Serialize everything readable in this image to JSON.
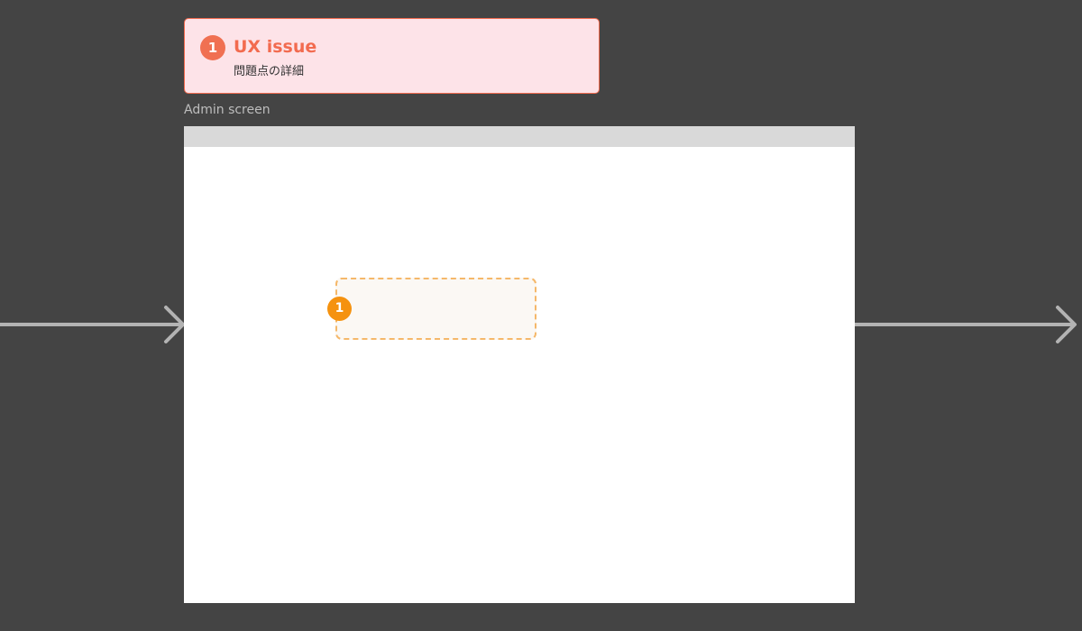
{
  "issue": {
    "number": "1",
    "title": "UX issue",
    "detail": "問題点の詳細"
  },
  "screen": {
    "label": "Admin screen",
    "marker_number": "1"
  },
  "colors": {
    "canvas_background": "#444444",
    "issue_accent": "#f26b4f",
    "issue_card_background": "#fde3e8",
    "marker_orange": "#f5920f",
    "arrow_gray": "#b3b3b3"
  }
}
